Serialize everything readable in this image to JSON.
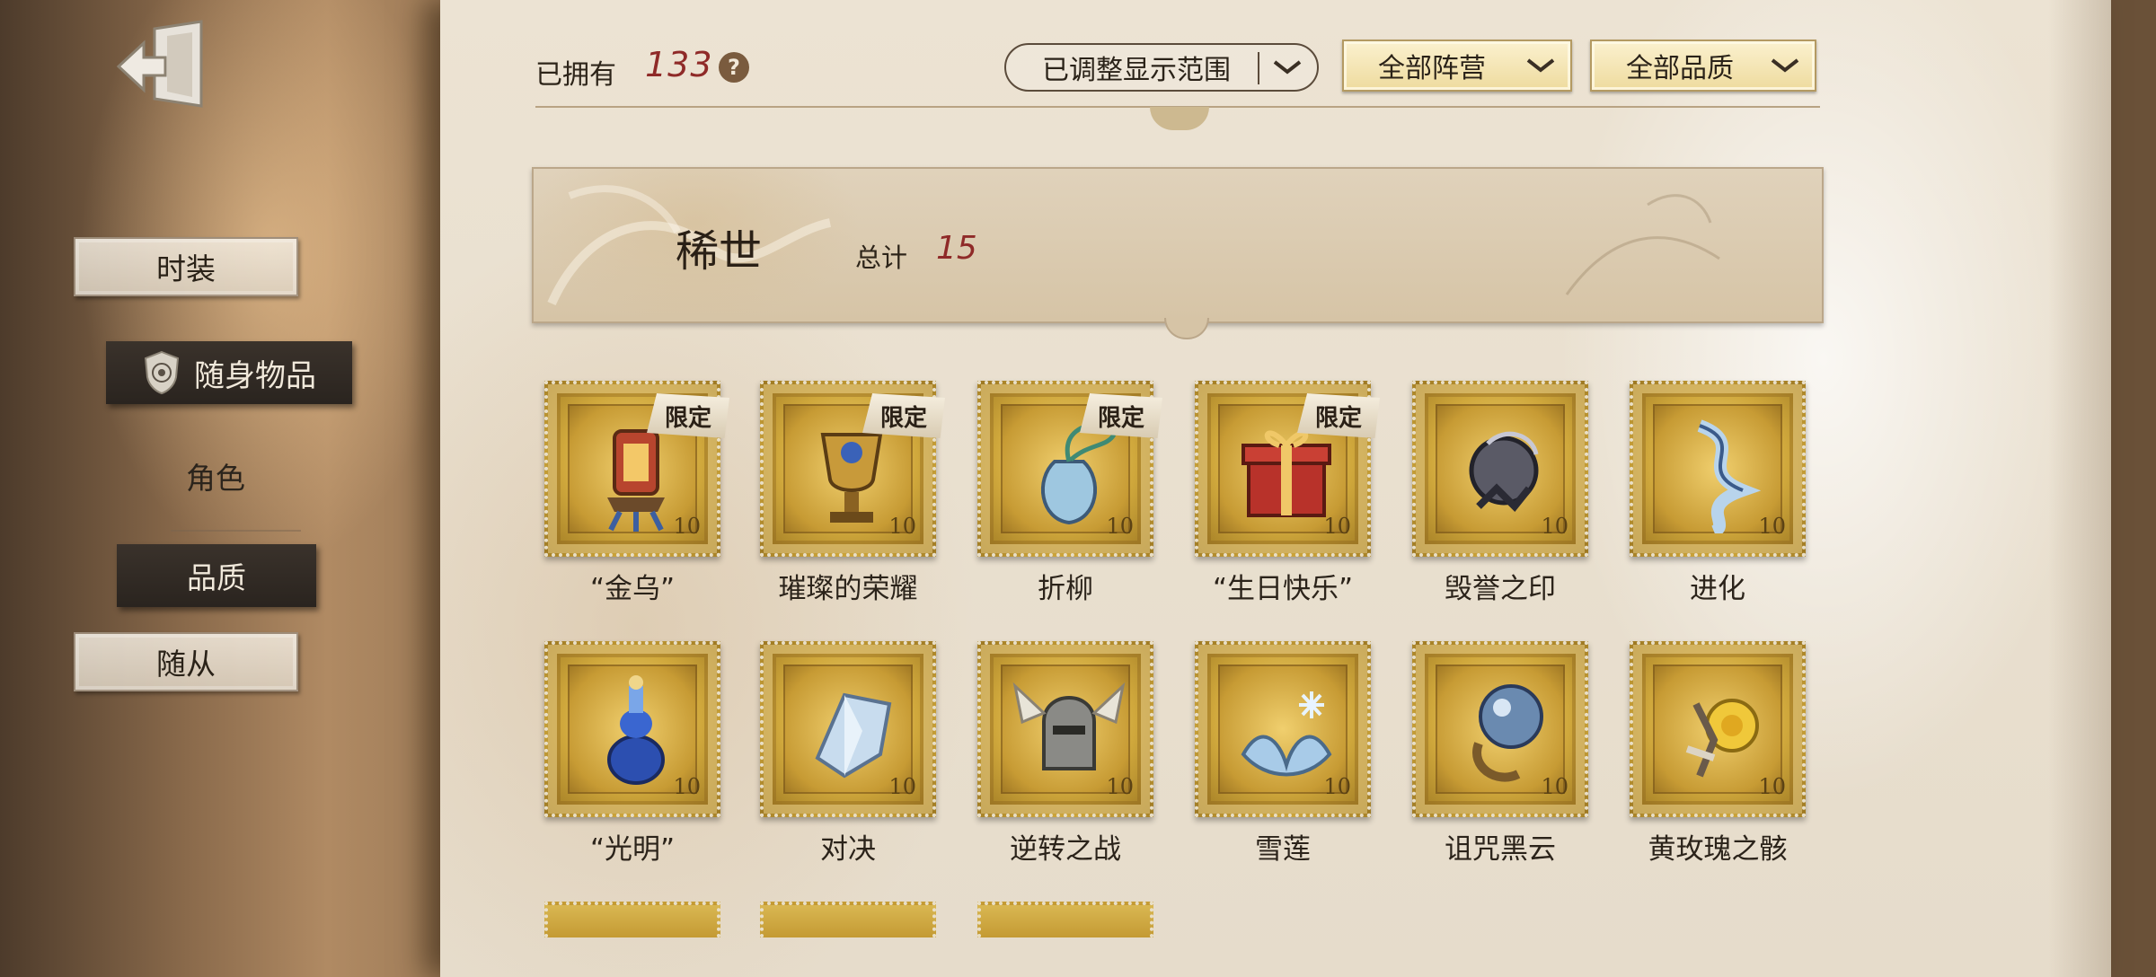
{
  "top_bar": {
    "owned_label": "已拥有",
    "owned_count": "133",
    "help_symbol": "?",
    "filters": {
      "range": "已调整显示范围",
      "camp": "全部阵营",
      "quality": "全部品质"
    }
  },
  "sidebar": {
    "items": [
      {
        "label": "时装",
        "state": "normal"
      },
      {
        "label": "随身物品",
        "state": "selected"
      },
      {
        "label": "角色",
        "state": "plain"
      },
      {
        "label": "品质",
        "state": "selected"
      },
      {
        "label": "随从",
        "state": "normal"
      }
    ]
  },
  "section": {
    "title": "稀世",
    "total_label": "总计",
    "total_count": "15"
  },
  "items": [
    {
      "name": "“金乌”",
      "tag": "限定",
      "icon": "golden-lantern-icon"
    },
    {
      "name": "璀璨的荣耀",
      "tag": "限定",
      "icon": "golden-trophy-icon"
    },
    {
      "name": "折柳",
      "tag": "限定",
      "icon": "willow-vase-icon"
    },
    {
      "name": "“生日快乐”",
      "tag": "限定",
      "icon": "gift-box-icon"
    },
    {
      "name": "毁誉之印",
      "tag": "",
      "icon": "dark-seal-icon"
    },
    {
      "name": "进化",
      "tag": "",
      "icon": "dna-crystal-icon"
    },
    {
      "name": "“光明”",
      "tag": "",
      "icon": "blue-lamp-icon"
    },
    {
      "name": "对决",
      "tag": "",
      "icon": "crystal-shard-icon"
    },
    {
      "name": "逆转之战",
      "tag": "",
      "icon": "winged-helmet-icon"
    },
    {
      "name": "雪莲",
      "tag": "",
      "icon": "snow-lotus-icon"
    },
    {
      "name": "诅咒黑云",
      "tag": "",
      "icon": "dark-orb-icon"
    },
    {
      "name": "黄玫瑰之骸",
      "tag": "",
      "icon": "yellow-rose-icon"
    }
  ],
  "stamp_mark": "10",
  "colors": {
    "accent_red": "#8f2a28",
    "stamp_gold": "#d0a83c",
    "selected_dark": "#2a241f"
  }
}
